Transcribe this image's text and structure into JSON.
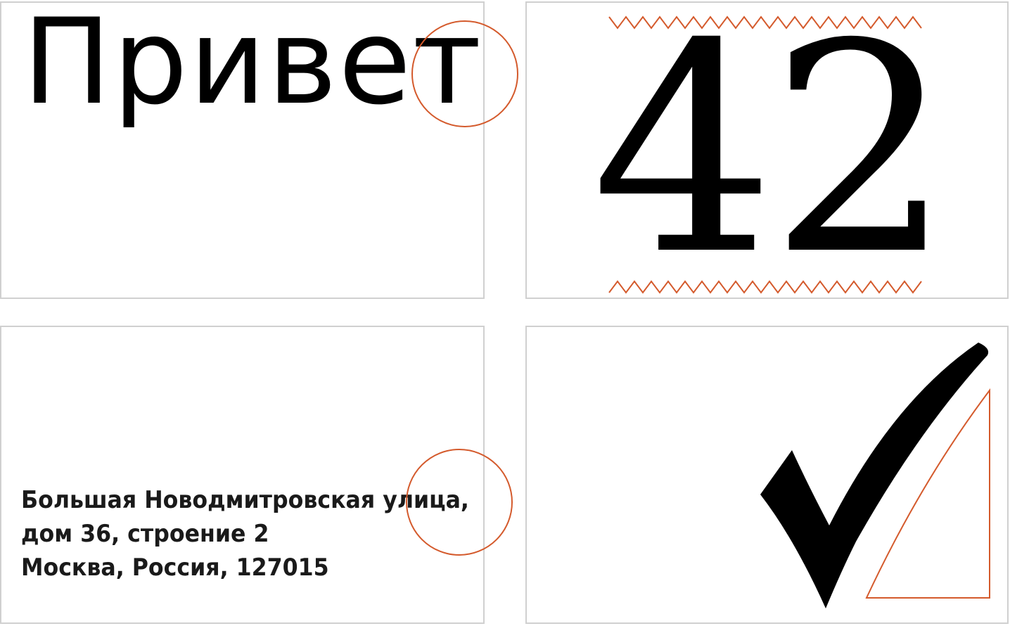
{
  "panels": {
    "greeting": {
      "text": "Привет"
    },
    "number": {
      "text": "42"
    },
    "address": {
      "lines": [
        "Большая Новодмитровская улица,",
        "дом 36, строение 2",
        "Москва, Россия, 127015"
      ]
    },
    "checkmark": {
      "icon": "checkmark-icon"
    }
  },
  "colors": {
    "accent": "#d45a2c",
    "border": "#d0d0d0",
    "text": "#000000"
  }
}
